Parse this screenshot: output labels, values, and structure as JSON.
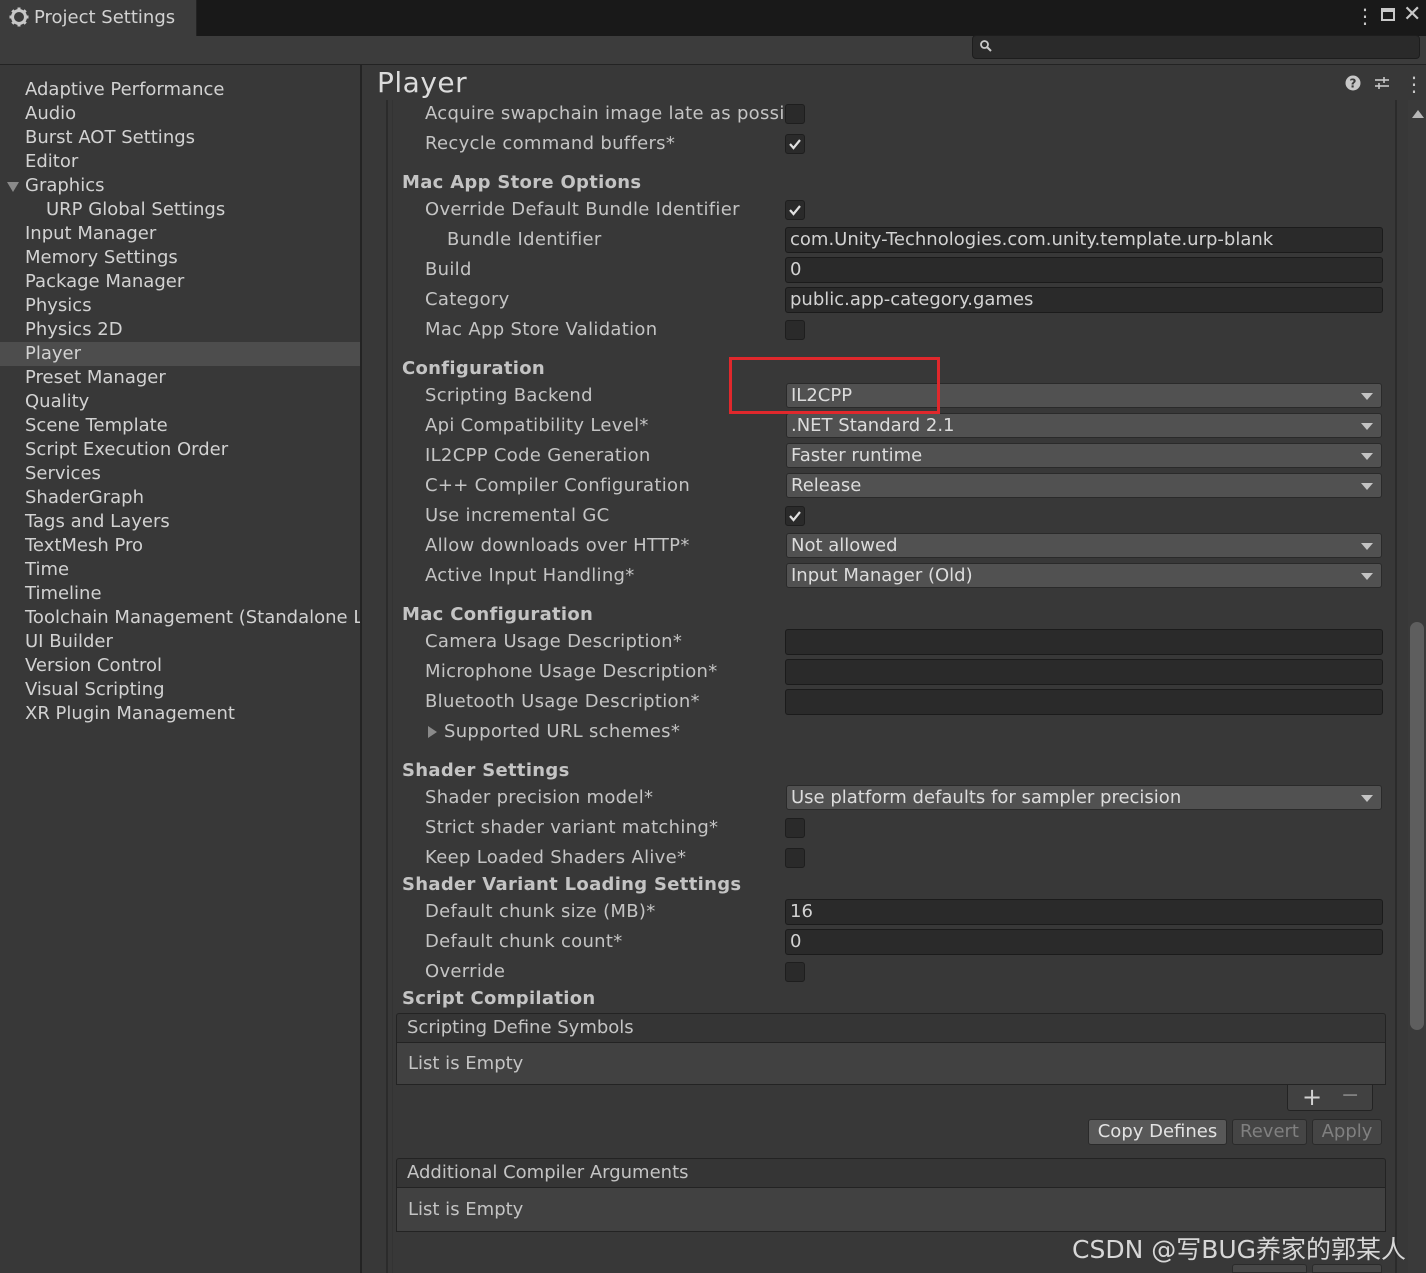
{
  "window": {
    "tab_title": "Project Settings",
    "search_placeholder": ""
  },
  "sidebar": {
    "items": [
      {
        "label": "Adaptive Performance"
      },
      {
        "label": "Audio"
      },
      {
        "label": "Burst AOT Settings"
      },
      {
        "label": "Editor"
      },
      {
        "label": "Graphics"
      },
      {
        "label": "URP Global Settings"
      },
      {
        "label": "Input Manager"
      },
      {
        "label": "Memory Settings"
      },
      {
        "label": "Package Manager"
      },
      {
        "label": "Physics"
      },
      {
        "label": "Physics 2D"
      },
      {
        "label": "Player"
      },
      {
        "label": "Preset Manager"
      },
      {
        "label": "Quality"
      },
      {
        "label": "Scene Template"
      },
      {
        "label": "Script Execution Order"
      },
      {
        "label": "Services"
      },
      {
        "label": "ShaderGraph"
      },
      {
        "label": "Tags and Layers"
      },
      {
        "label": "TextMesh Pro"
      },
      {
        "label": "Time"
      },
      {
        "label": "Timeline"
      },
      {
        "label": "Toolchain Management (Standalone L"
      },
      {
        "label": "UI Builder"
      },
      {
        "label": "Version Control"
      },
      {
        "label": "Visual Scripting"
      },
      {
        "label": "XR Plugin Management"
      }
    ],
    "selected": "Player"
  },
  "main": {
    "title": "Player",
    "rows": {
      "acquire_swapchain": {
        "label": "Acquire swapchain image late as possible",
        "checked": false
      },
      "recycle_buffers": {
        "label": "Recycle command buffers*",
        "checked": true
      },
      "mac_app_store_header": "Mac App Store Options",
      "override_bundle": {
        "label": "Override Default Bundle Identifier",
        "checked": true
      },
      "bundle_identifier": {
        "label": "Bundle Identifier",
        "value": "com.Unity-Technologies.com.unity.template.urp-blank"
      },
      "build": {
        "label": "Build",
        "value": "0"
      },
      "category": {
        "label": "Category",
        "value": "public.app-category.games"
      },
      "mac_validation": {
        "label": "Mac App Store Validation",
        "checked": false
      },
      "configuration_header": "Configuration",
      "scripting_backend": {
        "label": "Scripting Backend",
        "value": "IL2CPP"
      },
      "api_compat": {
        "label": "Api Compatibility Level*",
        "value": ".NET Standard 2.1"
      },
      "il2cpp_codegen": {
        "label": "IL2CPP Code Generation",
        "value": "Faster runtime"
      },
      "cpp_config": {
        "label": "C++ Compiler Configuration",
        "value": "Release"
      },
      "incremental_gc": {
        "label": "Use incremental GC",
        "checked": true
      },
      "http_downloads": {
        "label": "Allow downloads over HTTP*",
        "value": "Not allowed"
      },
      "input_handling": {
        "label": "Active Input Handling*",
        "value": "Input Manager (Old)"
      },
      "mac_config_header": "Mac Configuration",
      "camera_usage": {
        "label": "Camera Usage Description*",
        "value": ""
      },
      "mic_usage": {
        "label": "Microphone Usage Description*",
        "value": ""
      },
      "bluetooth_usage": {
        "label": "Bluetooth Usage Description*",
        "value": ""
      },
      "url_schemes": {
        "label": "Supported URL schemes*"
      },
      "shader_settings_header": "Shader Settings",
      "shader_precision": {
        "label": "Shader precision model*",
        "value": "Use platform defaults for sampler precision"
      },
      "strict_variant": {
        "label": "Strict shader variant matching*",
        "checked": false
      },
      "keep_loaded": {
        "label": "Keep Loaded Shaders Alive*",
        "checked": false
      },
      "shader_variant_header": "Shader Variant Loading Settings",
      "chunk_size": {
        "label": "Default chunk size (MB)*",
        "value": "16"
      },
      "chunk_count": {
        "label": "Default chunk count*",
        "value": "0"
      },
      "override": {
        "label": "Override",
        "checked": false
      },
      "script_compilation_header": "Script Compilation"
    },
    "define_symbols": {
      "title": "Scripting Define Symbols",
      "empty": "List is Empty",
      "add": "+",
      "remove": "−"
    },
    "buttons": {
      "copy_defines": "Copy Defines",
      "revert": "Revert",
      "apply": "Apply"
    },
    "compiler_args": {
      "title": "Additional Compiler Arguments",
      "empty": "List is Empty"
    }
  },
  "watermark": "CSDN @写BUG养家的郭某人",
  "colors": {
    "highlight": "#e0282c",
    "selected_row": "#4d4d4d",
    "background": "#383838"
  }
}
